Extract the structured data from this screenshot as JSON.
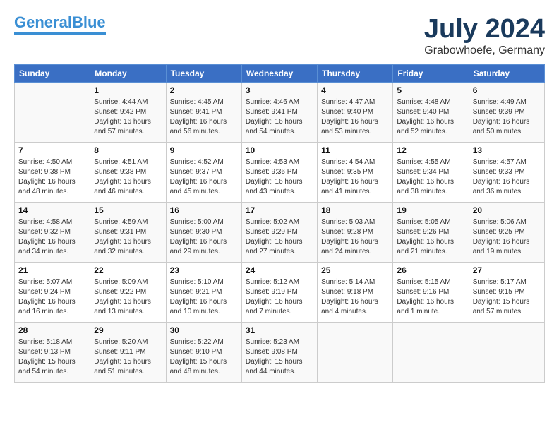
{
  "header": {
    "logo_line1": "General",
    "logo_line2": "Blue",
    "month": "July 2024",
    "location": "Grabowhoefe, Germany"
  },
  "weekdays": [
    "Sunday",
    "Monday",
    "Tuesday",
    "Wednesday",
    "Thursday",
    "Friday",
    "Saturday"
  ],
  "weeks": [
    [
      {
        "day": "",
        "info": ""
      },
      {
        "day": "1",
        "info": "Sunrise: 4:44 AM\nSunset: 9:42 PM\nDaylight: 16 hours\nand 57 minutes."
      },
      {
        "day": "2",
        "info": "Sunrise: 4:45 AM\nSunset: 9:41 PM\nDaylight: 16 hours\nand 56 minutes."
      },
      {
        "day": "3",
        "info": "Sunrise: 4:46 AM\nSunset: 9:41 PM\nDaylight: 16 hours\nand 54 minutes."
      },
      {
        "day": "4",
        "info": "Sunrise: 4:47 AM\nSunset: 9:40 PM\nDaylight: 16 hours\nand 53 minutes."
      },
      {
        "day": "5",
        "info": "Sunrise: 4:48 AM\nSunset: 9:40 PM\nDaylight: 16 hours\nand 52 minutes."
      },
      {
        "day": "6",
        "info": "Sunrise: 4:49 AM\nSunset: 9:39 PM\nDaylight: 16 hours\nand 50 minutes."
      }
    ],
    [
      {
        "day": "7",
        "info": "Sunrise: 4:50 AM\nSunset: 9:38 PM\nDaylight: 16 hours\nand 48 minutes."
      },
      {
        "day": "8",
        "info": "Sunrise: 4:51 AM\nSunset: 9:38 PM\nDaylight: 16 hours\nand 46 minutes."
      },
      {
        "day": "9",
        "info": "Sunrise: 4:52 AM\nSunset: 9:37 PM\nDaylight: 16 hours\nand 45 minutes."
      },
      {
        "day": "10",
        "info": "Sunrise: 4:53 AM\nSunset: 9:36 PM\nDaylight: 16 hours\nand 43 minutes."
      },
      {
        "day": "11",
        "info": "Sunrise: 4:54 AM\nSunset: 9:35 PM\nDaylight: 16 hours\nand 41 minutes."
      },
      {
        "day": "12",
        "info": "Sunrise: 4:55 AM\nSunset: 9:34 PM\nDaylight: 16 hours\nand 38 minutes."
      },
      {
        "day": "13",
        "info": "Sunrise: 4:57 AM\nSunset: 9:33 PM\nDaylight: 16 hours\nand 36 minutes."
      }
    ],
    [
      {
        "day": "14",
        "info": "Sunrise: 4:58 AM\nSunset: 9:32 PM\nDaylight: 16 hours\nand 34 minutes."
      },
      {
        "day": "15",
        "info": "Sunrise: 4:59 AM\nSunset: 9:31 PM\nDaylight: 16 hours\nand 32 minutes."
      },
      {
        "day": "16",
        "info": "Sunrise: 5:00 AM\nSunset: 9:30 PM\nDaylight: 16 hours\nand 29 minutes."
      },
      {
        "day": "17",
        "info": "Sunrise: 5:02 AM\nSunset: 9:29 PM\nDaylight: 16 hours\nand 27 minutes."
      },
      {
        "day": "18",
        "info": "Sunrise: 5:03 AM\nSunset: 9:28 PM\nDaylight: 16 hours\nand 24 minutes."
      },
      {
        "day": "19",
        "info": "Sunrise: 5:05 AM\nSunset: 9:26 PM\nDaylight: 16 hours\nand 21 minutes."
      },
      {
        "day": "20",
        "info": "Sunrise: 5:06 AM\nSunset: 9:25 PM\nDaylight: 16 hours\nand 19 minutes."
      }
    ],
    [
      {
        "day": "21",
        "info": "Sunrise: 5:07 AM\nSunset: 9:24 PM\nDaylight: 16 hours\nand 16 minutes."
      },
      {
        "day": "22",
        "info": "Sunrise: 5:09 AM\nSunset: 9:22 PM\nDaylight: 16 hours\nand 13 minutes."
      },
      {
        "day": "23",
        "info": "Sunrise: 5:10 AM\nSunset: 9:21 PM\nDaylight: 16 hours\nand 10 minutes."
      },
      {
        "day": "24",
        "info": "Sunrise: 5:12 AM\nSunset: 9:19 PM\nDaylight: 16 hours\nand 7 minutes."
      },
      {
        "day": "25",
        "info": "Sunrise: 5:14 AM\nSunset: 9:18 PM\nDaylight: 16 hours\nand 4 minutes."
      },
      {
        "day": "26",
        "info": "Sunrise: 5:15 AM\nSunset: 9:16 PM\nDaylight: 16 hours\nand 1 minute."
      },
      {
        "day": "27",
        "info": "Sunrise: 5:17 AM\nSunset: 9:15 PM\nDaylight: 15 hours\nand 57 minutes."
      }
    ],
    [
      {
        "day": "28",
        "info": "Sunrise: 5:18 AM\nSunset: 9:13 PM\nDaylight: 15 hours\nand 54 minutes."
      },
      {
        "day": "29",
        "info": "Sunrise: 5:20 AM\nSunset: 9:11 PM\nDaylight: 15 hours\nand 51 minutes."
      },
      {
        "day": "30",
        "info": "Sunrise: 5:22 AM\nSunset: 9:10 PM\nDaylight: 15 hours\nand 48 minutes."
      },
      {
        "day": "31",
        "info": "Sunrise: 5:23 AM\nSunset: 9:08 PM\nDaylight: 15 hours\nand 44 minutes."
      },
      {
        "day": "",
        "info": ""
      },
      {
        "day": "",
        "info": ""
      },
      {
        "day": "",
        "info": ""
      }
    ]
  ]
}
